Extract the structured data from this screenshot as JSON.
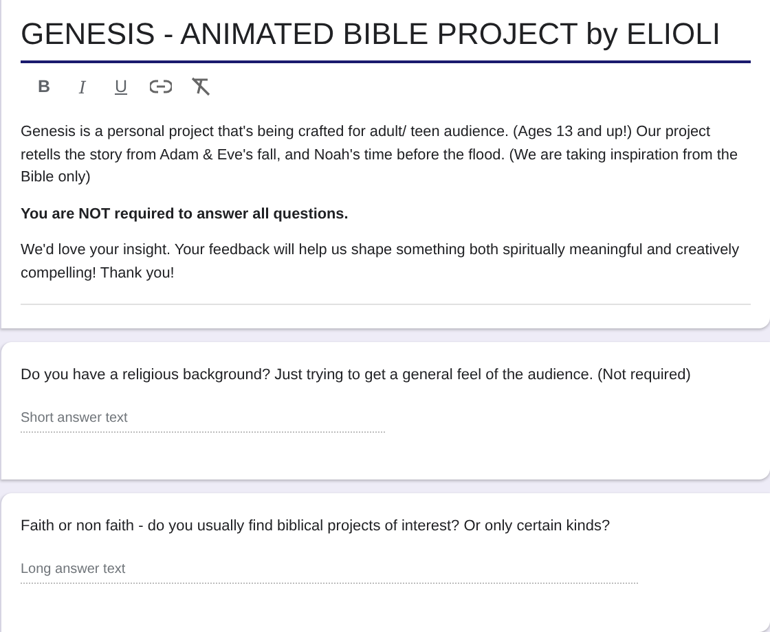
{
  "form": {
    "title": "GENESIS - ANIMATED BIBLE PROJECT by ELIOLI",
    "toolbar": [
      {
        "kind": "bold",
        "label": "B"
      },
      {
        "kind": "italic",
        "label": "I"
      },
      {
        "kind": "underline",
        "label": "U"
      },
      {
        "kind": "link"
      },
      {
        "kind": "clear"
      }
    ],
    "description": [
      {
        "kind": "plain",
        "text": "Genesis is a personal project that's being crafted for adult/ teen audience. (Ages 13 and up!) Our project retells the story from Adam & Eve's fall, and Noah's time before the flood. (We are taking inspiration from the Bible only)"
      },
      {
        "kind": "bold",
        "text": "You are NOT required to answer all questions."
      },
      {
        "kind": "plain",
        "text": "We'd love your insight. Your feedback will help us shape something both spiritually meaningful and creatively compelling! Thank you!"
      }
    ]
  },
  "questions": [
    {
      "text": "Do you have a religious background? Just trying to get a general feel of the audience. (Not required)",
      "kind": "short",
      "placeholder": "Short answer text"
    },
    {
      "text": "Faith or non faith - do you usually find biblical projects of interest? Or only certain kinds?",
      "kind": "long",
      "placeholder": "Long answer text"
    }
  ]
}
